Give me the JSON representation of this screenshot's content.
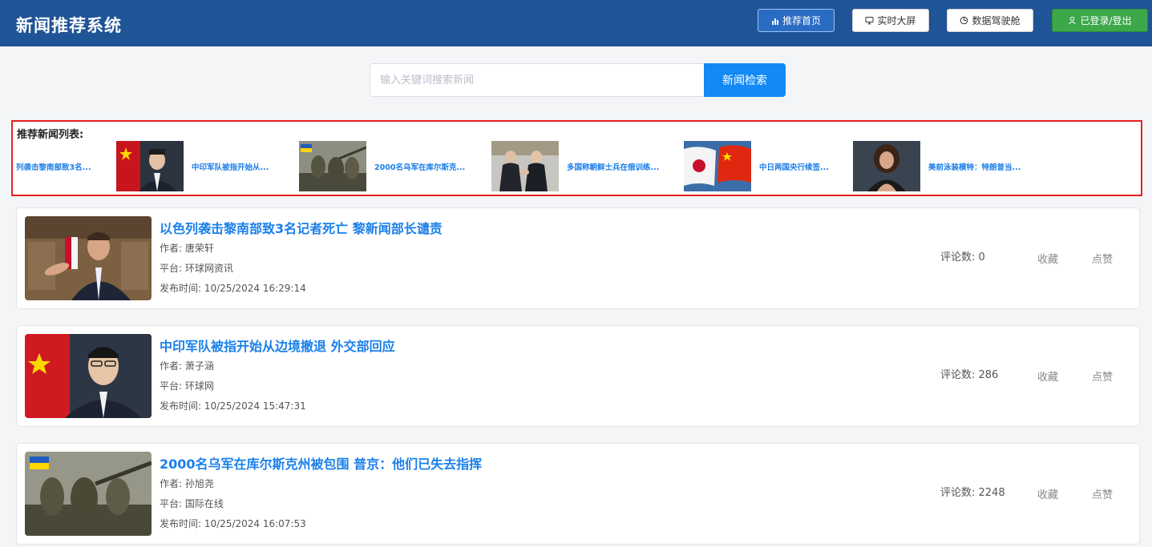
{
  "header": {
    "title": "新闻推荐系统",
    "nav": {
      "home": "推荐首页",
      "screen": "实时大屏",
      "cockpit": "数据驾驶舱",
      "login": "已登录/登出"
    }
  },
  "search": {
    "placeholder": "输入关键词搜索新闻",
    "button": "新闻检索"
  },
  "recommend": {
    "title": "推荐新闻列表:",
    "items": [
      {
        "text": "列袭击黎南部致3名..."
      },
      {
        "text": "中印军队被指开始从..."
      },
      {
        "text": "2000名乌军在库尔斯克..."
      },
      {
        "text": "多国称朝鲜士兵在俄训练..."
      },
      {
        "text": "中日两国央行续签..."
      },
      {
        "text": "美前泳装模特：特朗普当..."
      }
    ]
  },
  "news": [
    {
      "title": "以色列袭击黎南部致3名记者死亡 黎新闻部长谴责",
      "author": "作者: 唐荣轩",
      "platform": "平台: 环球网资讯",
      "time": "发布时间: 10/25/2024 16:29:14",
      "comments": "评论数: 0",
      "fav": "收藏",
      "like": "点赞"
    },
    {
      "title": "中印军队被指开始从边境撤退 外交部回应",
      "author": "作者: 萧子涵",
      "platform": "平台: 环球网",
      "time": "发布时间: 10/25/2024 15:47:31",
      "comments": "评论数: 286",
      "fav": "收藏",
      "like": "点赞"
    },
    {
      "title": "2000名乌军在库尔斯克州被包围 普京：他们已失去指挥",
      "author": "作者: 孙旭尧",
      "platform": "平台: 国际在线",
      "time": "发布时间: 10/25/2024 16:07:53",
      "comments": "评论数: 2248",
      "fav": "收藏",
      "like": "点赞"
    }
  ],
  "colors": {
    "header_bg": "#1f5496",
    "accent": "#1289f5",
    "link": "#1a80ea",
    "highlight_border": "#e52222",
    "login_green": "#3da84a"
  }
}
